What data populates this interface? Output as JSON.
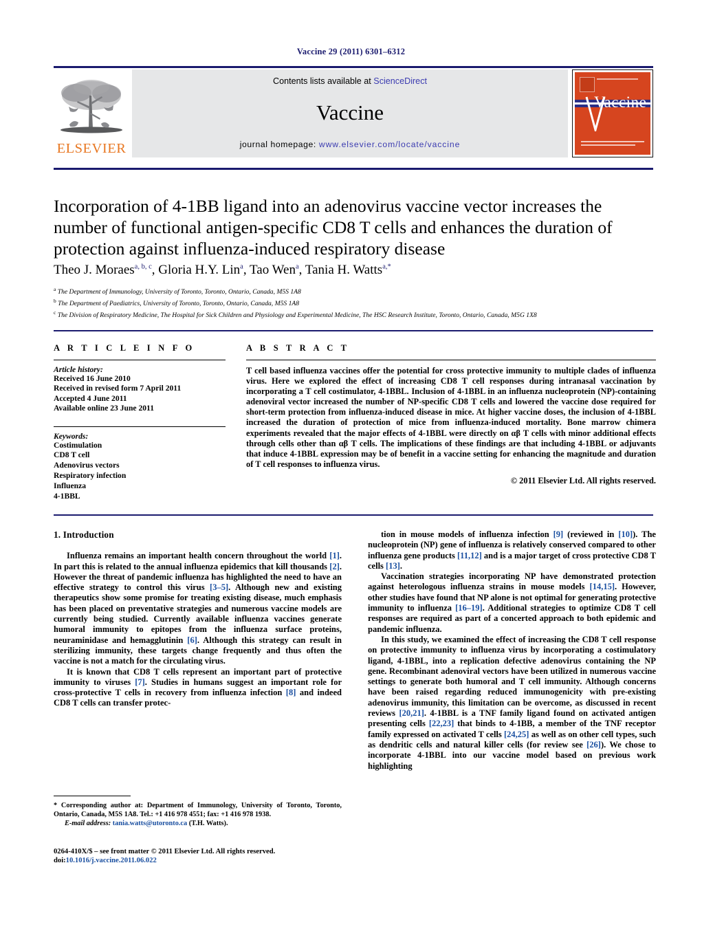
{
  "running_head": "Vaccine 29 (2011) 6301–6312",
  "masthead": {
    "elsevier_wordmark": "ELSEVIER",
    "contents_line_prefix": "Contents lists available at ",
    "sciencedirect": "ScienceDirect",
    "journal_name": "Vaccine",
    "homepage_label": "journal homepage:",
    "homepage_url": "www.elsevier.com/locate/vaccine",
    "cover_title": "Vaccine",
    "accent_orange": "#E87722",
    "cover_orange": "#D6451F",
    "link_blue": "#3b3bb0",
    "rule_navy": "#1a1a6e"
  },
  "article": {
    "title": "Incorporation of 4-1BB ligand into an adenovirus vaccine vector increases the number of functional antigen-specific CD8 T cells and enhances the duration of protection against influenza-induced respiratory disease",
    "authors": [
      {
        "name": "Theo J. Moraes",
        "marks": "a, b, c"
      },
      {
        "name": "Gloria H.Y. Lin",
        "marks": "a"
      },
      {
        "name": "Tao Wen",
        "marks": "a"
      },
      {
        "name": "Tania H. Watts",
        "marks": "a,*"
      }
    ],
    "affiliations": [
      {
        "mark": "a",
        "text": "The Department of Immunology, University of Toronto, Toronto, Ontario, Canada, M5S 1A8"
      },
      {
        "mark": "b",
        "text": "The Department of Paediatrics, University of Toronto, Toronto, Ontario, Canada, M5S 1A8"
      },
      {
        "mark": "c",
        "text": "The Division of Respiratory Medicine, The Hospital for Sick Children and Physiology and Experimental Medicine, The HSC Research Institute, Toronto, Ontario, Canada, M5G 1X8"
      }
    ]
  },
  "article_info": {
    "heading": "A R T I C L E    I N F O",
    "history_label": "Article history:",
    "history": [
      "Received 16 June 2010",
      "Received in revised form 7 April 2011",
      "Accepted 4 June 2011",
      "Available online 23 June 2011"
    ],
    "keywords_label": "Keywords:",
    "keywords": [
      "Costimulation",
      "CD8 T cell",
      "Adenovirus vectors",
      "Respiratory infection",
      "Influenza",
      "4-1BBL"
    ]
  },
  "abstract": {
    "heading": "A B S T R A C T",
    "text": "T cell based influenza vaccines offer the potential for cross protective immunity to multiple clades of influenza virus. Here we explored the effect of increasing CD8 T cell responses during intranasal vaccination by incorporating a T cell costimulator, 4-1BBL. Inclusion of 4-1BBL in an influenza nucleoprotein (NP)-containing adenoviral vector increased the number of NP-specific CD8 T cells and lowered the vaccine dose required for short-term protection from influenza-induced disease in mice. At higher vaccine doses, the inclusion of 4-1BBL increased the duration of protection of mice from influenza-induced mortality. Bone marrow chimera experiments revealed that the major effects of 4-1BBL were directly on αβ T cells with minor additional effects through cells other than αβ T cells. The implications of these findings are that including 4-1BBL or adjuvants that induce 4-1BBL expression may be of benefit in a vaccine setting for enhancing the magnitude and duration of T cell responses to influenza virus.",
    "copyright": "© 2011 Elsevier Ltd. All rights reserved."
  },
  "body": {
    "section_number_title": "1.  Introduction",
    "left_paragraphs": [
      [
        {
          "t": "Influenza remains an important health concern throughout the world "
        },
        {
          "t": "[1]",
          "ref": true
        },
        {
          "t": ". In part this is related to the annual influenza epidemics that kill thousands "
        },
        {
          "t": "[2]",
          "ref": true
        },
        {
          "t": ". However the threat of pandemic influenza has highlighted the need to have an effective strategy to control this virus "
        },
        {
          "t": "[3–5]",
          "ref": true
        },
        {
          "t": ". Although new and existing therapeutics show some promise for treating existing disease, much emphasis has been placed on preventative strategies and numerous vaccine models are currently being studied. Currently available influenza vaccines generate humoral immunity to epitopes from the influenza surface proteins, neuraminidase and hemagglutinin "
        },
        {
          "t": "[6]",
          "ref": true
        },
        {
          "t": ". Although this strategy can result in sterilizing immunity, these targets change frequently and thus often the vaccine is not a match for the circulating virus."
        }
      ],
      [
        {
          "t": "It is known that CD8 T cells represent an important part of protective immunity to viruses "
        },
        {
          "t": "[7]",
          "ref": true
        },
        {
          "t": ". Studies in humans suggest an important role for cross-protective T cells in recovery from influenza infection "
        },
        {
          "t": "[8]",
          "ref": true
        },
        {
          "t": " and indeed CD8 T cells can transfer protec-"
        }
      ]
    ],
    "right_paragraphs": [
      [
        {
          "t": "tion in mouse models of influenza infection "
        },
        {
          "t": "[9]",
          "ref": true
        },
        {
          "t": " (reviewed in "
        },
        {
          "t": "[10]",
          "ref": true
        },
        {
          "t": "). The nucleoprotein (NP) gene of influenza is relatively conserved compared to other influenza gene products "
        },
        {
          "t": "[11,12]",
          "ref": true
        },
        {
          "t": " and is a major target of cross protective CD8 T cells "
        },
        {
          "t": "[13]",
          "ref": true
        },
        {
          "t": "."
        }
      ],
      [
        {
          "t": "Vaccination strategies incorporating NP have demonstrated protection against heterologous influenza strains in mouse models "
        },
        {
          "t": "[14,15]",
          "ref": true
        },
        {
          "t": ". However, other studies have found that NP alone is not optimal for generating protective immunity to influenza "
        },
        {
          "t": "[16–19]",
          "ref": true
        },
        {
          "t": ". Additional strategies to optimize CD8 T cell responses are required as part of a concerted approach to both epidemic and pandemic influenza."
        }
      ],
      [
        {
          "t": "In this study, we examined the effect of increasing the CD8 T cell response on protective immunity to influenza virus by incorporating a costimulatory ligand, 4-1BBL, into a replication defective adenovirus containing the NP gene. Recombinant adenoviral vectors have been utilized in numerous vaccine settings to generate both humoral and T cell immunity. Although concerns have been raised regarding reduced immunogenicity with pre-existing adenovirus immunity, this limitation can be overcome, as discussed in recent reviews "
        },
        {
          "t": "[20,21]",
          "ref": true
        },
        {
          "t": ". 4-1BBL is a TNF family ligand found on activated antigen presenting cells "
        },
        {
          "t": "[22,23]",
          "ref": true
        },
        {
          "t": " that binds to 4-1BB, a member of the TNF receptor family expressed on activated T cells "
        },
        {
          "t": "[24,25]",
          "ref": true
        },
        {
          "t": " as well as on other cell types, such as dendritic cells and natural killer cells (for review see "
        },
        {
          "t": "[26]",
          "ref": true
        },
        {
          "t": "). We chose to incorporate 4-1BBL into our vaccine model based on previous work highlighting"
        }
      ]
    ]
  },
  "footnote": {
    "corresponding": "* Corresponding author at: Department of Immunology, University of Toronto, Toronto, Ontario, Canada, M5S 1A8. Tel.: +1 416 978 4551; fax: +1 416 978 1938.",
    "email_label": "E-mail address:",
    "email": "tania.watts@utoronto.ca",
    "email_suffix": "(T.H. Watts)."
  },
  "colophon": {
    "issn_line": "0264-410X/$ – see front matter © 2011 Elsevier Ltd. All rights reserved.",
    "doi_label": "doi:",
    "doi": "10.1016/j.vaccine.2011.06.022"
  }
}
